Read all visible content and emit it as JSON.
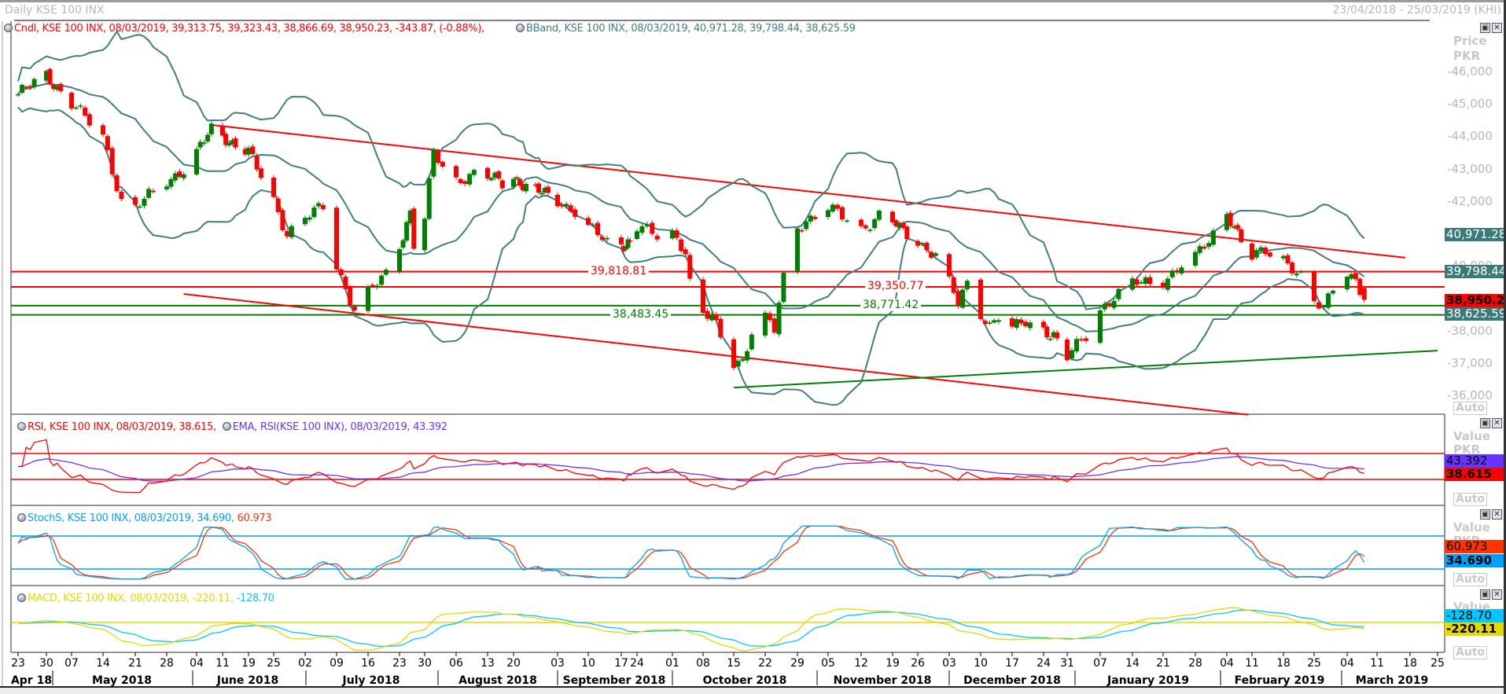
{
  "header": {
    "title": "Daily KSE 100 INX",
    "date_range": "23/04/2018 - 25/03/2019 (KHI)"
  },
  "legend": {
    "candle": "Cndl, KSE 100 INX, 08/03/2019, 39,313.75, 39,323.43, 38,866.69, 38,950.23, -343.87, (-0.88%),",
    "bband": "BBand, KSE 100 INX, 08/03/2019, 40,971.28, 39,798.44, 38,625.59",
    "rsi": "RSI, KSE 100 INX, 08/03/2019, 38.615,",
    "ema": "EMA, RSI(KSE 100 INX), 08/03/2019, 43.392",
    "stoch": "StochS, KSE 100 INX, 08/03/2019, 34.690,",
    "stoch_d": "60.973",
    "macd": "MACD, KSE 100 INX, 08/03/2019, -220.11,",
    "macd_signal": "-128.70"
  },
  "price_axis": {
    "title": "Price",
    "unit": "PKR",
    "labels": [
      "46,000",
      "45,000",
      "44,000",
      "43,000",
      "42,000",
      "40,000",
      "38,000",
      "37,000",
      "36,000"
    ],
    "auto": "Auto",
    "boxes": {
      "bb_upper": "40,971.28",
      "bb_mid": "39,798.44",
      "close": "38,950.23",
      "bb_lower": "38,625.59"
    }
  },
  "rsi_axis": {
    "title": "Value",
    "unit": "PKR",
    "ema": "43.392",
    "rsi": "38.615",
    "auto": "Auto"
  },
  "stoch_axis": {
    "title": "Value",
    "unit": "PKR",
    "d": "60.973",
    "k": "34.690",
    "auto": "Auto"
  },
  "macd_axis": {
    "title": "Value",
    "signal": "-128.70",
    "macd": "-220.11",
    "auto": "Auto"
  },
  "levels": [
    {
      "label": "39,818.81",
      "value": 39818.81,
      "color": "#ff0000"
    },
    {
      "label": "39,350.77",
      "value": 39350.77,
      "color": "#ff0000"
    },
    {
      "label": "38,771.42",
      "value": 38771.42,
      "color": "#008000"
    },
    {
      "label": "38,483.45",
      "value": 38483.45,
      "color": "#008000"
    }
  ],
  "x_axis": {
    "ticks": [
      "23",
      "30",
      "07",
      "14",
      "21",
      "28",
      "04",
      "11",
      "19",
      "25",
      "02",
      "09",
      "16",
      "23",
      "30",
      "06",
      "13",
      "20",
      "03",
      "10",
      "17",
      "24",
      "01",
      "08",
      "15",
      "22",
      "29",
      "05",
      "12",
      "19",
      "26",
      "03",
      "10",
      "17",
      "24",
      "31",
      "07",
      "14",
      "21",
      "28",
      "04",
      "11",
      "18",
      "25",
      "04",
      "11",
      "18",
      "25"
    ],
    "months": [
      "Apr 18",
      "May 2018",
      "June 2018",
      "July 2018",
      "August 2018",
      "September 2018",
      "October 2018",
      "November 2018",
      "December 2018",
      "January 2019",
      "February 2019",
      "March 2019"
    ]
  },
  "colors": {
    "up": "#008000",
    "down": "#ff0000",
    "bband": "#3f7f80",
    "rsi": "#ff0000",
    "ema": "#6633ff",
    "stoch_k": "#00a0ff",
    "stoch_d": "#ff3300",
    "macd": "#e6d800",
    "signal": "#00c8ff"
  },
  "chart_data": {
    "type": "candlestick",
    "title": "Daily KSE 100 INX",
    "ylabel": "Price PKR",
    "ylim": [
      35700,
      46700
    ],
    "last_candle": {
      "date": "2019-03-08",
      "open": 39313.75,
      "high": 39323.43,
      "low": 38866.69,
      "close": 38950.23,
      "change": -343.87,
      "change_pct": -0.88
    },
    "close_anchors": [
      [
        "2018-04-23",
        45300
      ],
      [
        "2018-04-30",
        45900
      ],
      [
        "2018-05-07",
        45000
      ],
      [
        "2018-05-14",
        44000
      ],
      [
        "2018-05-18",
        42000
      ],
      [
        "2018-05-21",
        41800
      ],
      [
        "2018-05-28",
        42600
      ],
      [
        "2018-06-01",
        43000
      ],
      [
        "2018-06-04",
        43500
      ],
      [
        "2018-06-08",
        44200
      ],
      [
        "2018-06-11",
        44000
      ],
      [
        "2018-06-19",
        43500
      ],
      [
        "2018-06-25",
        42000
      ],
      [
        "2018-06-28",
        41000
      ],
      [
        "2018-07-02",
        41500
      ],
      [
        "2018-07-06",
        41800
      ],
      [
        "2018-07-09",
        40000
      ],
      [
        "2018-07-11",
        39300
      ],
      [
        "2018-07-13",
        38700
      ],
      [
        "2018-07-16",
        39200
      ],
      [
        "2018-07-20",
        39700
      ],
      [
        "2018-07-23",
        40600
      ],
      [
        "2018-07-26",
        41700
      ],
      [
        "2018-07-27",
        40700
      ],
      [
        "2018-07-30",
        41500
      ],
      [
        "2018-08-01",
        43500
      ],
      [
        "2018-08-03",
        43000
      ],
      [
        "2018-08-06",
        42600
      ],
      [
        "2018-08-10",
        42900
      ],
      [
        "2018-08-13",
        42800
      ],
      [
        "2018-08-17",
        42500
      ],
      [
        "2018-08-20",
        42700
      ],
      [
        "2018-08-24",
        42500
      ],
      [
        "2018-09-03",
        42000
      ],
      [
        "2018-09-07",
        41700
      ],
      [
        "2018-09-10",
        41200
      ],
      [
        "2018-09-14",
        40700
      ],
      [
        "2018-09-17",
        40600
      ],
      [
        "2018-09-21",
        40800
      ],
      [
        "2018-09-24",
        41200
      ],
      [
        "2018-09-28",
        40900
      ],
      [
        "2018-10-01",
        41000
      ],
      [
        "2018-10-04",
        40500
      ],
      [
        "2018-10-05",
        39500
      ],
      [
        "2018-10-08",
        38500
      ],
      [
        "2018-10-10",
        38400
      ],
      [
        "2018-10-12",
        37800
      ],
      [
        "2018-10-15",
        37000
      ],
      [
        "2018-10-17",
        37100
      ],
      [
        "2018-10-19",
        38000
      ],
      [
        "2018-10-22",
        38400
      ],
      [
        "2018-10-24",
        38000
      ],
      [
        "2018-10-26",
        39600
      ],
      [
        "2018-10-29",
        41200
      ],
      [
        "2018-11-01",
        41500
      ],
      [
        "2018-11-05",
        41800
      ],
      [
        "2018-11-08",
        41500
      ],
      [
        "2018-11-12",
        41100
      ],
      [
        "2018-11-16",
        41600
      ],
      [
        "2018-11-19",
        41400
      ],
      [
        "2018-11-22",
        41000
      ],
      [
        "2018-11-26",
        40700
      ],
      [
        "2018-11-30",
        40400
      ],
      [
        "2018-12-03",
        39500
      ],
      [
        "2018-12-05",
        38800
      ],
      [
        "2018-12-07",
        39400
      ],
      [
        "2018-12-10",
        38500
      ],
      [
        "2018-12-12",
        38200
      ],
      [
        "2018-12-14",
        38500
      ],
      [
        "2018-12-17",
        38100
      ],
      [
        "2018-12-20",
        38200
      ],
      [
        "2018-12-24",
        38000
      ],
      [
        "2018-12-27",
        37900
      ],
      [
        "2018-12-31",
        37200
      ],
      [
        "2019-01-02",
        37500
      ],
      [
        "2019-01-04",
        37800
      ],
      [
        "2019-01-07",
        38600
      ],
      [
        "2019-01-10",
        39100
      ],
      [
        "2019-01-14",
        39500
      ],
      [
        "2019-01-18",
        39400
      ],
      [
        "2019-01-21",
        39500
      ],
      [
        "2019-01-25",
        40100
      ],
      [
        "2019-01-28",
        40300
      ],
      [
        "2019-01-31",
        40700
      ],
      [
        "2019-02-04",
        41600
      ],
      [
        "2019-02-06",
        41300
      ],
      [
        "2019-02-08",
        40800
      ],
      [
        "2019-02-11",
        40300
      ],
      [
        "2019-02-14",
        40400
      ],
      [
        "2019-02-18",
        40200
      ],
      [
        "2019-02-20",
        40000
      ],
      [
        "2019-02-22",
        39700
      ],
      [
        "2019-02-25",
        38900
      ],
      [
        "2019-02-27",
        38600
      ],
      [
        "2019-03-01",
        39300
      ],
      [
        "2019-03-04",
        39800
      ],
      [
        "2019-03-06",
        39600
      ],
      [
        "2019-03-07",
        39313.75
      ]
    ],
    "trendlines": [
      {
        "name": "upper-channel",
        "color": "#ff0000",
        "from": [
          "2018-06-08",
          44350
        ],
        "to": [
          "2019-03-17",
          40250
        ]
      },
      {
        "name": "lower-channel",
        "color": "#ff0000",
        "from": [
          "2018-06-01",
          39130
        ],
        "to": [
          "2019-02-10",
          35400
        ]
      },
      {
        "name": "support",
        "color": "#008000",
        "from": [
          "2018-10-15",
          36240
        ],
        "to": [
          "2019-03-25",
          37380
        ]
      }
    ],
    "indicators": {
      "bband": {
        "period": 20,
        "stdev": 2
      },
      "rsi": {
        "period": 14,
        "levels": [
          70,
          30
        ]
      },
      "stoch": {
        "levels": [
          80,
          20
        ]
      },
      "macd": {
        "fast": 12,
        "slow": 26,
        "signal": 9
      }
    }
  }
}
